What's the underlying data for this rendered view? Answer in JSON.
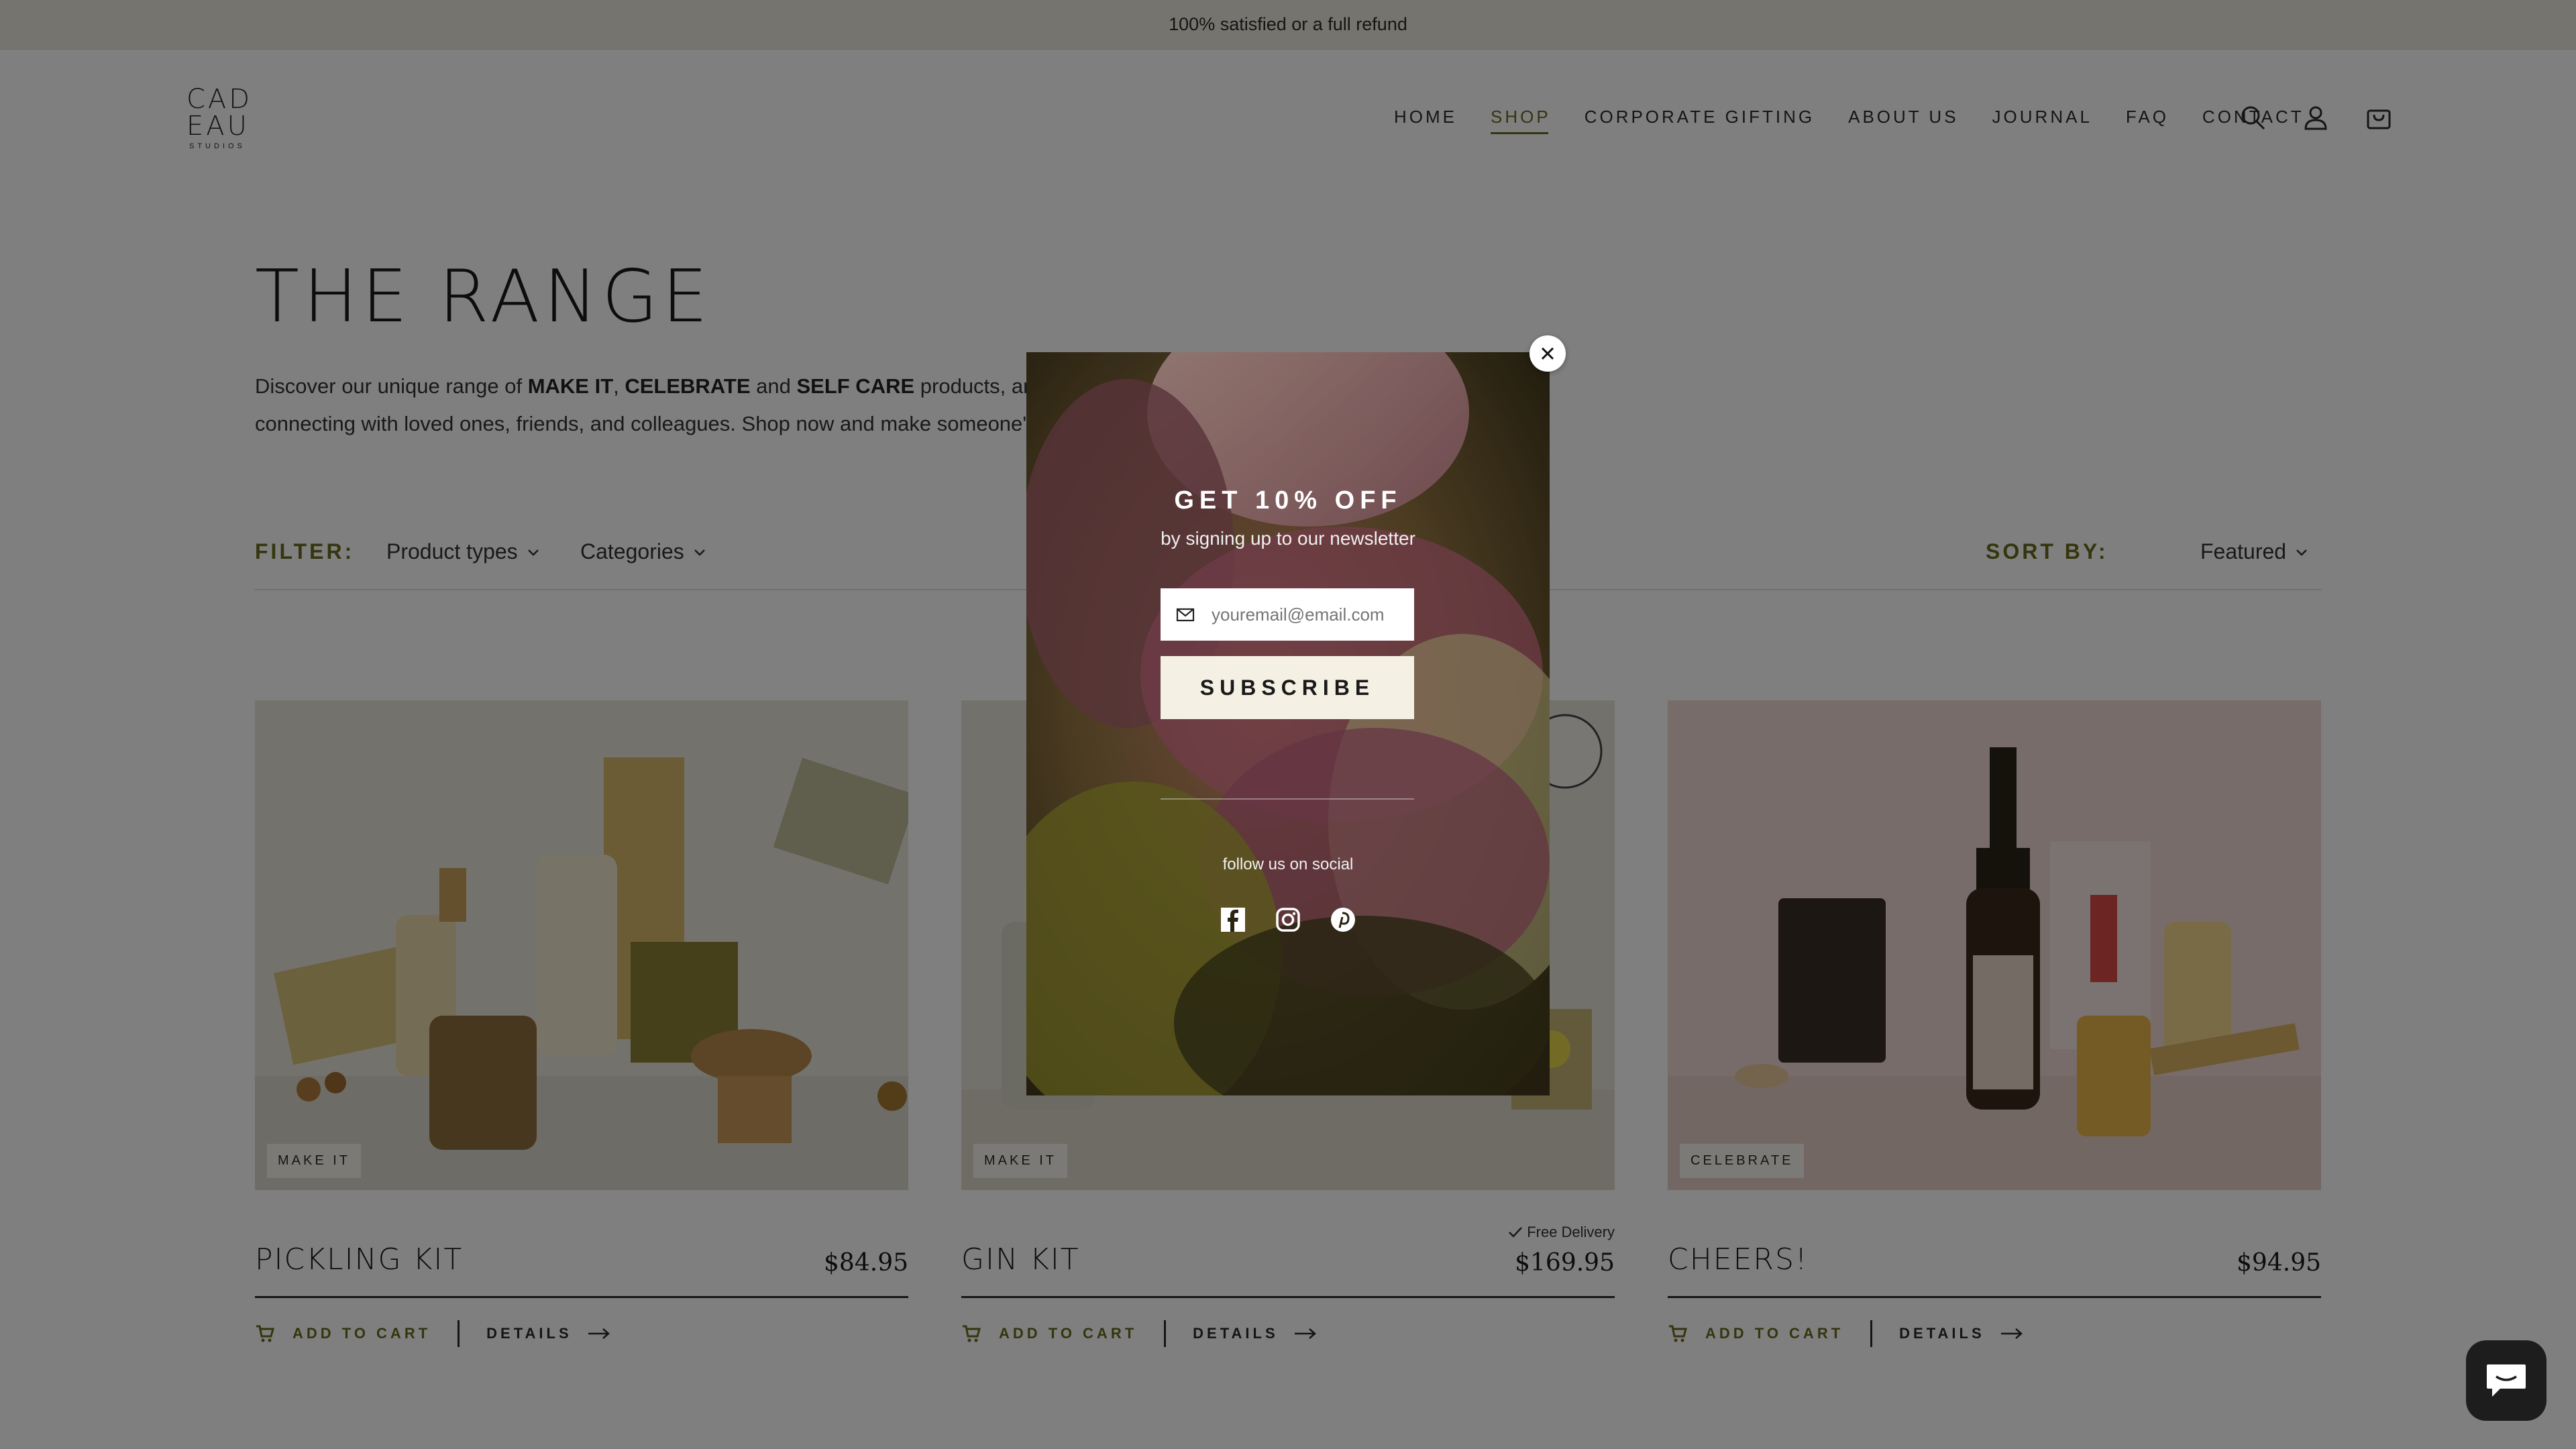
{
  "announcement": "100% satisfied or a full refund",
  "logo": {
    "line1": "CAD",
    "line2": "EAU",
    "line3": "STUDIOS"
  },
  "nav": [
    "HOME",
    "SHOP",
    "CORPORATE GIFTING",
    "ABOUT US",
    "JOURNAL",
    "FAQ",
    "CONTACT"
  ],
  "nav_active": "SHOP",
  "header_icons": [
    "search-icon",
    "account-icon",
    "cart-icon"
  ],
  "page": {
    "title": "THE RANGE",
    "intro_a": "Discover our unique range of ",
    "intro_make": "MAKE IT",
    "intro_comma": ", ",
    "intro_celebrate": "CELEBRATE",
    "intro_and": " and ",
    "intro_selfcare": "SELF CARE",
    "intro_b": " products, and handp",
    "intro_c": "connecting with loved ones, friends, and colleagues. Shop now and make someone's da"
  },
  "filter": {
    "label": "FILTER:",
    "product_types": "Product types",
    "categories": "Categories",
    "sort_label": "SORT BY:",
    "sort_value": "Featured"
  },
  "products": [
    {
      "badge": "MAKE IT",
      "name": "PICKLING KIT",
      "price": "$84.95",
      "add": "ADD TO CART",
      "details": "DETAILS"
    },
    {
      "badge": "MAKE IT",
      "name": "GIN KIT",
      "price": "$169.95",
      "add": "ADD TO CART",
      "details": "DETAILS",
      "free_delivery": "Free Delivery"
    },
    {
      "badge": "CELEBRATE",
      "name": "CHEERS!",
      "price": "$94.95",
      "add": "ADD TO CART",
      "details": "DETAILS"
    }
  ],
  "modal": {
    "title": "GET 10% OFF",
    "subtitle": "by signing up to our newsletter",
    "email_placeholder": "youremail@email.com",
    "subscribe": "SUBSCRIBE",
    "follow": "follow us on social",
    "social": [
      "facebook-icon",
      "instagram-icon",
      "pinterest-icon"
    ]
  },
  "colors": {
    "accent": "#6b6a1d",
    "announce_bg": "#ebe9df",
    "button_bg": "#f4f1e4"
  }
}
